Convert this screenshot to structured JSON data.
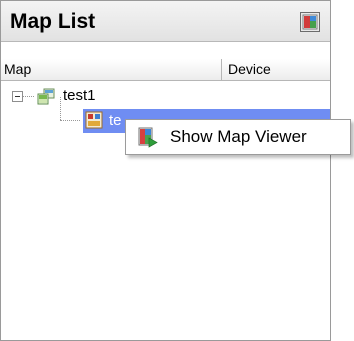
{
  "panel": {
    "title": "Map List",
    "header_button_icon": "map-viewer-icon"
  },
  "columns": {
    "map": "Map",
    "device": "Device"
  },
  "tree": {
    "root": {
      "label": "test1",
      "expanded": true,
      "icon": "map-group-icon"
    },
    "child": {
      "label": "te",
      "selected": true,
      "icon": "map-icon"
    }
  },
  "context_menu": {
    "items": [
      {
        "label": "Show Map Viewer",
        "icon": "show-map-viewer-icon"
      }
    ]
  },
  "colors": {
    "selection": "#6f8df2",
    "header_bg": "#e8e8e8",
    "border": "#9a9a9a"
  }
}
